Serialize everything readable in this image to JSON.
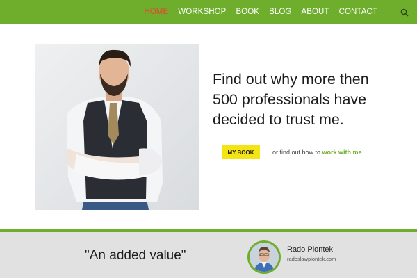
{
  "nav": {
    "items": [
      {
        "label": "HOME",
        "active": true
      },
      {
        "label": "WORKSHOP",
        "active": false
      },
      {
        "label": "BOOK",
        "active": false
      },
      {
        "label": "BLOG",
        "active": false
      },
      {
        "label": "ABOUT",
        "active": false
      },
      {
        "label": "CONTACT",
        "active": false
      }
    ],
    "search_icon": "search-icon"
  },
  "hero": {
    "headline_lines": [
      "Find out why more then",
      "500 professionals have",
      "decided to trust me."
    ],
    "button_label": "MY BOOK",
    "cta_text": "or find out how to ",
    "cta_link": "work with me",
    "cta_end": "."
  },
  "testimonial": {
    "quote": "\"An added value\"",
    "author_name": "Rado Piontek",
    "author_site": "radoslawpiontek.com"
  },
  "colors": {
    "brand_green": "#6fae2c",
    "active_nav": "#e2492e",
    "button_yellow": "#f5e414",
    "band_gray": "#e1e1e1"
  }
}
